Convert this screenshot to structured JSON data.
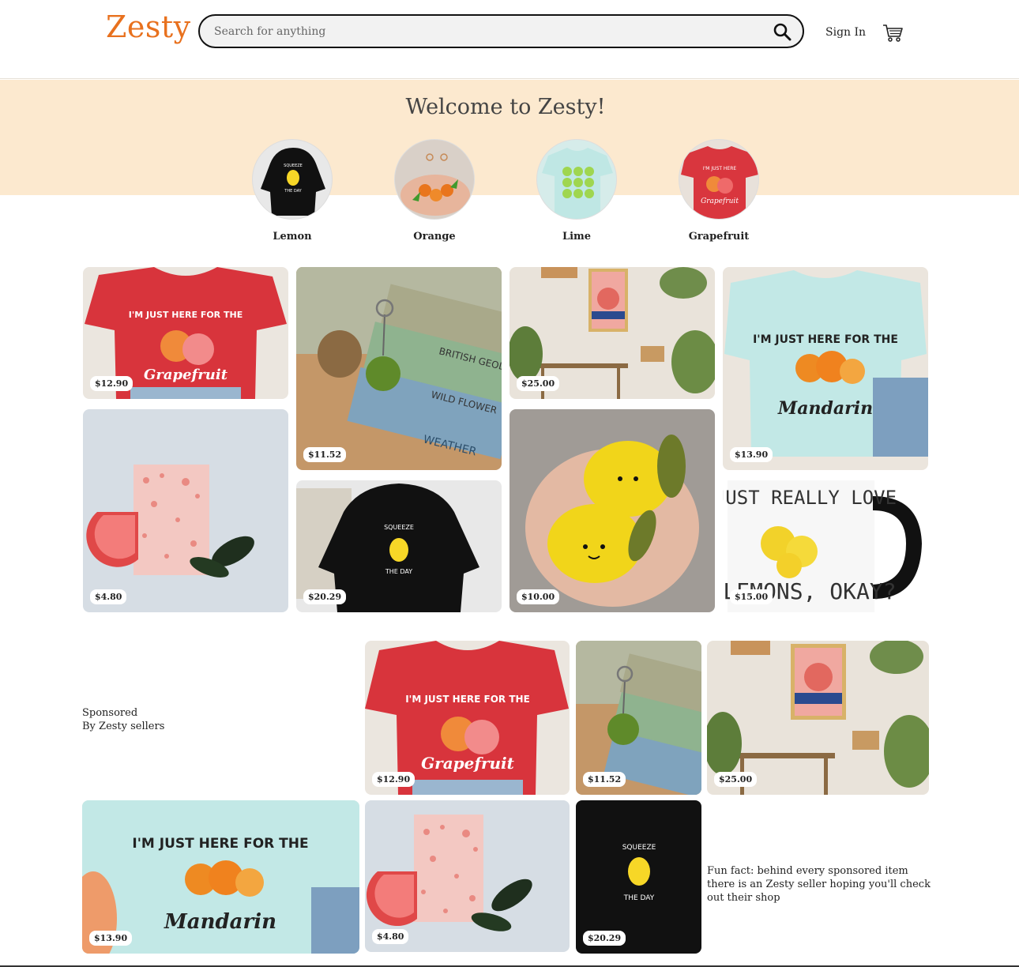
{
  "header": {
    "logo": "Zesty",
    "search_placeholder": "Search for anything",
    "sign_in": "Sign In"
  },
  "banner": {
    "welcome": "Welcome to Zesty!",
    "categories": [
      {
        "label": "Lemon"
      },
      {
        "label": "Orange"
      },
      {
        "label": "Lime"
      },
      {
        "label": "Grapefruit"
      }
    ]
  },
  "grid": {
    "items": [
      {
        "price": "$12.90"
      },
      {
        "price": "$11.52"
      },
      {
        "price": "$25.00"
      },
      {
        "price": "$13.90"
      },
      {
        "price": "$4.80"
      },
      {
        "price": "$20.29"
      },
      {
        "price": "$10.00"
      },
      {
        "price": "$15.00"
      }
    ]
  },
  "sponsored": {
    "line1": "Sponsored",
    "line2": "By Zesty sellers",
    "items": [
      {
        "price": "$12.90"
      },
      {
        "price": "$11.52"
      },
      {
        "price": "$25.00"
      },
      {
        "price": "$13.90"
      },
      {
        "price": "$4.80"
      },
      {
        "price": "$20.29"
      }
    ],
    "fun_fact": "Fun fact: behind every sponsored item there is an Zesty seller hoping you'll check out their shop"
  },
  "colors": {
    "brand": "#e8711e",
    "banner": "#fce9cf"
  }
}
